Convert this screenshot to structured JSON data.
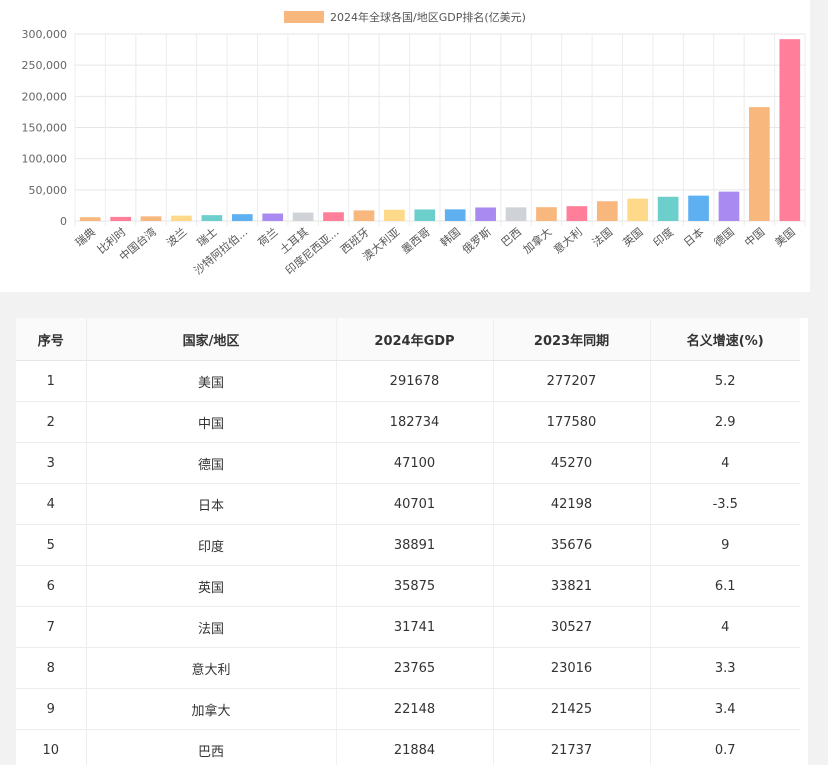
{
  "chart_data": {
    "type": "bar",
    "legend": "2024年全球各国/地区GDP排名(亿美元)",
    "legend_position": "top",
    "categories": [
      "瑞典",
      "比利时",
      "中国台湾",
      "波兰",
      "瑞士",
      "沙特阿拉伯...",
      "荷兰",
      "土耳其",
      "印度尼西亚...",
      "西班牙",
      "澳大利亚",
      "墨西哥",
      "韩国",
      "俄罗斯",
      "巴西",
      "加拿大",
      "意大利",
      "法国",
      "英国",
      "印度",
      "日本",
      "德国",
      "中国",
      "美国"
    ],
    "values": [
      6000,
      6600,
      7500,
      8600,
      9400,
      11000,
      12000,
      13500,
      14000,
      17000,
      18000,
      18500,
      18700,
      21700,
      21884,
      22148,
      23765,
      31741,
      35875,
      38891,
      40701,
      47100,
      182734,
      291678
    ],
    "yticks": [
      "0",
      "50,000",
      "100,000",
      "150,000",
      "200,000",
      "250,000",
      "300,000"
    ],
    "ylim": [
      0,
      300000
    ],
    "grid": true,
    "colors": [
      "#f7b77d",
      "#ff7f9a",
      "#f7b77d",
      "#ffd98a",
      "#6ccfcc",
      "#5eb0f0",
      "#a98af0",
      "#cfd2d6",
      "#ff7f9a",
      "#f7b77d",
      "#ffd98a",
      "#6ccfcc",
      "#5eb0f0",
      "#a98af0",
      "#cfd2d6",
      "#f7b77d",
      "#ff7f9a",
      "#f7b77d",
      "#ffd98a",
      "#6ccfcc",
      "#5eb0f0",
      "#a98af0",
      "#f7b77d",
      "#ff7f9a"
    ]
  },
  "table": {
    "headers": [
      "序号",
      "国家/地区",
      "2024年GDP",
      "2023年同期",
      "名义增速(%)"
    ],
    "rows": [
      [
        "1",
        "美国",
        "291678",
        "277207",
        "5.2"
      ],
      [
        "2",
        "中国",
        "182734",
        "177580",
        "2.9"
      ],
      [
        "3",
        "德国",
        "47100",
        "45270",
        "4"
      ],
      [
        "4",
        "日本",
        "40701",
        "42198",
        "-3.5"
      ],
      [
        "5",
        "印度",
        "38891",
        "35676",
        "9"
      ],
      [
        "6",
        "英国",
        "35875",
        "33821",
        "6.1"
      ],
      [
        "7",
        "法国",
        "31741",
        "30527",
        "4"
      ],
      [
        "8",
        "意大利",
        "23765",
        "23016",
        "3.3"
      ],
      [
        "9",
        "加拿大",
        "22148",
        "21425",
        "3.4"
      ],
      [
        "10",
        "巴西",
        "21884",
        "21737",
        "0.7"
      ]
    ]
  }
}
